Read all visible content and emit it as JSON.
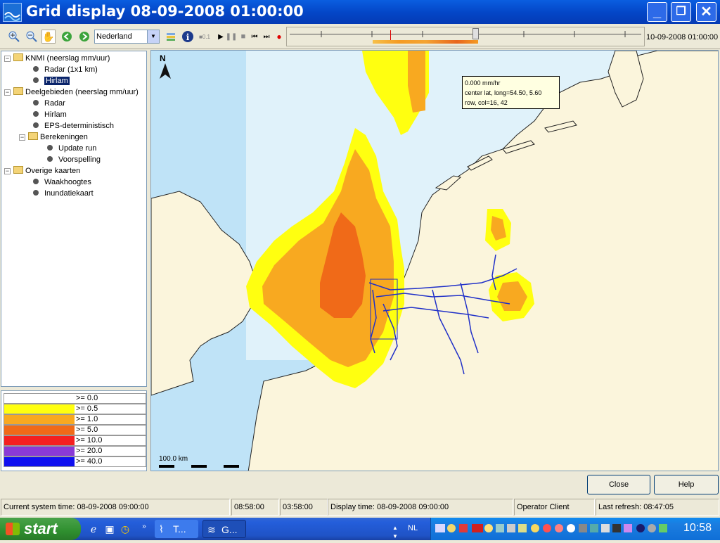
{
  "window": {
    "title": "Grid display 08-09-2008 01:00:00",
    "minimize": "_",
    "maximize": "❐",
    "close": "✕"
  },
  "toolbar": {
    "region": "Nederland",
    "timeline_time": "10-09-2008 01:00:00",
    "icons": [
      "zoom-in-icon",
      "zoom-out-icon",
      "pan-hand-icon",
      "back-icon",
      "forward-icon",
      "layers-icon",
      "info-icon",
      "step-icon",
      "play-icon",
      "pause-icon",
      "stop-icon",
      "prev-icon",
      "next-icon",
      "record-icon"
    ],
    "step_label": "0.1"
  },
  "tree": {
    "nodes": [
      {
        "label": "KNMI (neerslag mm/uur)",
        "type": "folder"
      },
      {
        "label": "Radar (1x1 km)",
        "type": "leaf"
      },
      {
        "label": "Hirlam",
        "type": "leaf",
        "selected": true
      },
      {
        "label": "Deelgebieden (neerslag mm/uur)",
        "type": "folder"
      },
      {
        "label": "Radar",
        "type": "leaf"
      },
      {
        "label": "Hirlam",
        "type": "leaf"
      },
      {
        "label": "EPS-deterministisch",
        "type": "leaf"
      },
      {
        "label": "Berekeningen",
        "type": "folder"
      },
      {
        "label": "Update run",
        "type": "leaf"
      },
      {
        "label": "Voorspelling",
        "type": "leaf"
      },
      {
        "label": "Overige kaarten",
        "type": "folder"
      },
      {
        "label": "Waakhoogtes",
        "type": "leaf"
      },
      {
        "label": "Inundatiekaart",
        "type": "leaf"
      }
    ]
  },
  "legend": [
    {
      "label": ">= 0.0",
      "color": "#ffffff"
    },
    {
      "label": ">= 0.5",
      "color": "#ffff10"
    },
    {
      "label": ">= 1.0",
      "color": "#f8a920"
    },
    {
      "label": ">= 5.0",
      "color": "#f06a18"
    },
    {
      "label": ">= 10.0",
      "color": "#f42020"
    },
    {
      "label": ">= 20.0",
      "color": "#8a3ad6"
    },
    {
      "label": ">= 40.0",
      "color": "#1010f0"
    }
  ],
  "map": {
    "north": "N",
    "scale_label": "100.0 km",
    "tooltip": {
      "line1": "0.000 mm/hr",
      "line2": "center lat, long=54.50, 5.60",
      "line3": "row, col=16, 42"
    }
  },
  "buttons": {
    "close": "Close",
    "help": "Help"
  },
  "status": {
    "system_time": "Current system time: 08-09-2008 09:00:00",
    "t1": "08:58:00",
    "t2": "03:58:00",
    "display_time": "Display time: 08-09-2008 09:00:00",
    "client": "Operator Client",
    "last_refresh": "Last refresh: 08:47:05"
  },
  "taskbar": {
    "start": "start",
    "task1": "T...",
    "task2": "G...",
    "lang": "NL",
    "clock": "10:58"
  }
}
